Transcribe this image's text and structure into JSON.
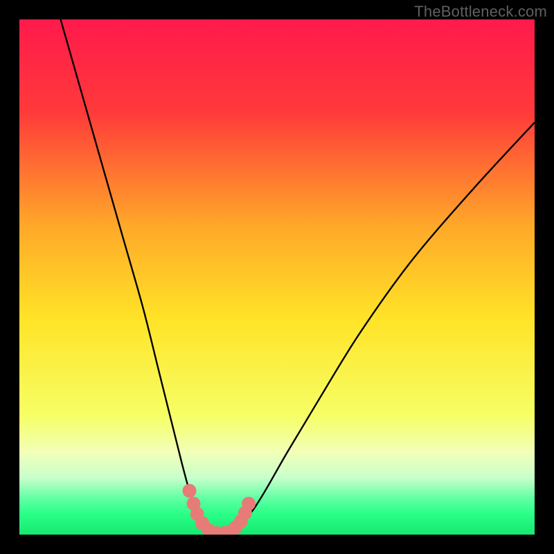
{
  "watermark": "TheBottleneck.com",
  "chart_data": {
    "type": "line",
    "title": "",
    "xlabel": "",
    "ylabel": "",
    "xlim": [
      0,
      100
    ],
    "ylim": [
      0,
      100
    ],
    "gradient_stops": [
      {
        "offset": 0,
        "color": "#ff1a4b"
      },
      {
        "offset": 18,
        "color": "#ff3a3a"
      },
      {
        "offset": 40,
        "color": "#ffa829"
      },
      {
        "offset": 58,
        "color": "#ffe327"
      },
      {
        "offset": 77,
        "color": "#f6ff66"
      },
      {
        "offset": 84,
        "color": "#f2ffb8"
      },
      {
        "offset": 89,
        "color": "#c7ffcb"
      },
      {
        "offset": 93,
        "color": "#5fffa3"
      },
      {
        "offset": 96,
        "color": "#2aff88"
      },
      {
        "offset": 100,
        "color": "#16e86f"
      }
    ],
    "series": [
      {
        "name": "left-curve",
        "x": [
          8,
          12,
          16,
          20,
          24,
          27,
          29.5,
          31.5,
          33,
          34.3,
          35.2,
          36,
          36.7,
          37.3,
          37.8
        ],
        "y": [
          100,
          86,
          72,
          58,
          44,
          32,
          22,
          14,
          8.5,
          5,
          3,
          1.8,
          1,
          0.5,
          0.3
        ]
      },
      {
        "name": "right-curve",
        "x": [
          41,
          42,
          43.5,
          45.5,
          48,
          52,
          58,
          66,
          76,
          88,
          100
        ],
        "y": [
          0.3,
          1,
          2.5,
          5,
          9,
          16,
          26,
          39,
          53,
          67,
          80
        ]
      }
    ],
    "valley_floor": {
      "x_start": 37.8,
      "x_end": 41,
      "y": 0.1
    },
    "markers": {
      "name": "valley-dots",
      "color": "#e77b77",
      "radius": 10,
      "points": [
        {
          "x": 33.0,
          "y": 8.5
        },
        {
          "x": 33.8,
          "y": 6.0
        },
        {
          "x": 34.5,
          "y": 4.0
        },
        {
          "x": 35.5,
          "y": 2.2
        },
        {
          "x": 36.8,
          "y": 0.8
        },
        {
          "x": 38.3,
          "y": 0.3
        },
        {
          "x": 39.8,
          "y": 0.3
        },
        {
          "x": 41.0,
          "y": 0.6
        },
        {
          "x": 42.0,
          "y": 1.4
        },
        {
          "x": 43.0,
          "y": 2.6
        },
        {
          "x": 43.8,
          "y": 4.2
        },
        {
          "x": 44.5,
          "y": 6.0
        }
      ]
    }
  }
}
